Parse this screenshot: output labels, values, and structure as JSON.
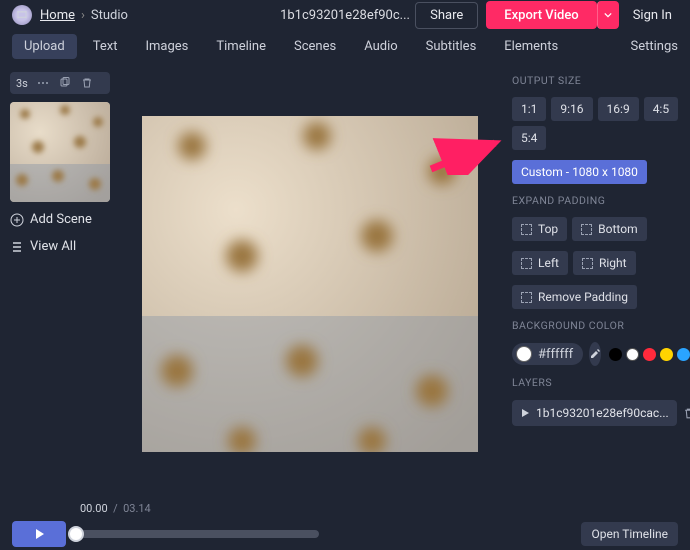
{
  "header": {
    "home": "Home",
    "studio": "Studio",
    "project_title": "1b1c93201e28ef90c...",
    "share": "Share",
    "export": "Export Video",
    "sign_in": "Sign In"
  },
  "tabs": {
    "items": [
      "Upload",
      "Text",
      "Images",
      "Timeline",
      "Scenes",
      "Audio",
      "Subtitles",
      "Elements"
    ],
    "settings": "Settings",
    "active_index": 0
  },
  "left": {
    "duration_badge": "3s",
    "add_scene": "Add Scene",
    "view_all": "View All"
  },
  "right": {
    "output_size_label": "OUTPUT SIZE",
    "ratios": [
      "1:1",
      "9:16",
      "16:9",
      "4:5",
      "5:4"
    ],
    "custom": "Custom - 1080 x 1080",
    "expand_padding_label": "EXPAND PADDING",
    "pad_top": "Top",
    "pad_bottom": "Bottom",
    "pad_left": "Left",
    "pad_right": "Right",
    "remove_padding": "Remove Padding",
    "bg_label": "BACKGROUND COLOR",
    "bg_hex": "#ffffff",
    "palette": [
      "#000000",
      "#ffffff",
      "#ff2a3c",
      "#ffd400",
      "#2aa4ff"
    ],
    "layers_label": "LAYERS",
    "layer_name": "1b1c93201e28ef90cac..."
  },
  "timeline": {
    "current": "00.00",
    "total": "03.14",
    "open_timeline": "Open Timeline"
  },
  "colors": {
    "accent_pink": "#ff2a65",
    "accent_blue": "#5a6fd8"
  }
}
